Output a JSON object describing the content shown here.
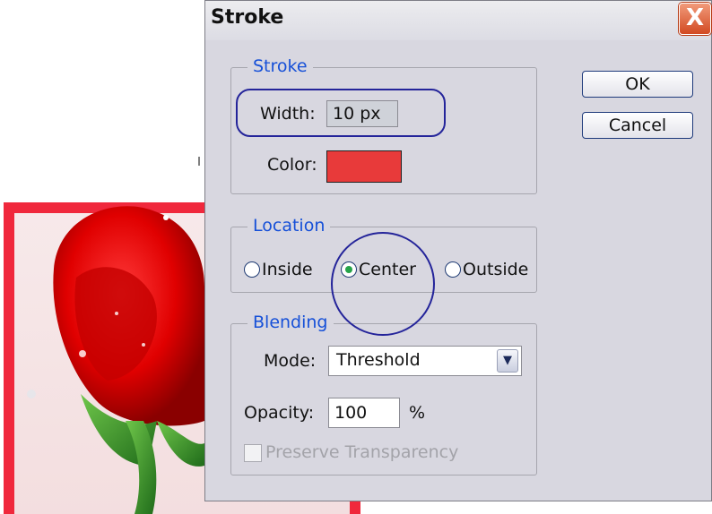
{
  "dialog": {
    "title": "Stroke",
    "close_label": "X",
    "stroke_group": {
      "legend": "Stroke",
      "width_label": "Width:",
      "width_value": "10 px",
      "color_label": "Color:",
      "color_value": "#e83a3a"
    },
    "location_group": {
      "legend": "Location",
      "options": [
        {
          "label": "Inside",
          "selected": false
        },
        {
          "label": "Center",
          "selected": true
        },
        {
          "label": "Outside",
          "selected": false
        }
      ]
    },
    "blending_group": {
      "legend": "Blending",
      "mode_label": "Mode:",
      "mode_value": "Threshold",
      "opacity_label": "Opacity:",
      "opacity_value": "100",
      "opacity_unit": "%",
      "preserve_label": "Preserve Transparency",
      "preserve_checked": false
    },
    "buttons": {
      "ok_label": "OK",
      "cancel_label": "Cancel"
    }
  },
  "icons": {
    "close": "close-x-icon",
    "dropdown": "chevron-down-icon"
  },
  "colors": {
    "legend_text": "#1650d8",
    "annotation": "#24249a",
    "canvas_stroke": "#f0283c"
  }
}
